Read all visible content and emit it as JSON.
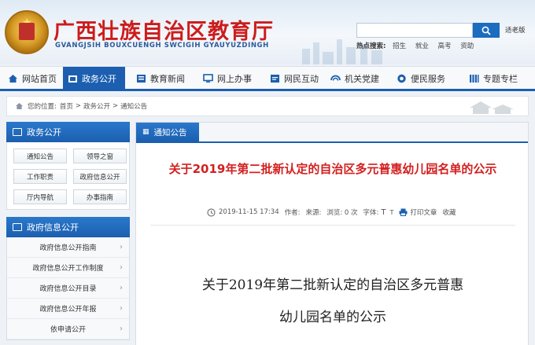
{
  "header": {
    "site_title": "广西壮族自治区教育厅",
    "site_subtitle": "GVANGJSIH BOUXCUENGH SWCIGIH GYAUYUZDINGH",
    "accessibility_label": "适老版",
    "hot_search": {
      "label": "热点搜索:",
      "keywords": [
        "招生",
        "就业",
        "高考",
        "资助"
      ]
    }
  },
  "nav": {
    "items": [
      {
        "label": "网站首页",
        "icon": "home-icon"
      },
      {
        "label": "政务公开",
        "icon": "folder-icon",
        "active": true
      },
      {
        "label": "教育新闻",
        "icon": "news-icon"
      },
      {
        "label": "网上办事",
        "icon": "monitor-icon"
      },
      {
        "label": "网民互动",
        "icon": "chat-icon"
      },
      {
        "label": "机关党建",
        "icon": "flag-icon"
      },
      {
        "label": "便民服务",
        "icon": "service-icon"
      },
      {
        "label": "专题专栏",
        "icon": "columns-icon"
      }
    ]
  },
  "breadcrumb": {
    "prefix": "您的位置:",
    "items": [
      "首页",
      "政务公开",
      "通知公告"
    ]
  },
  "sidebar": {
    "panel1_title": "政务公开",
    "buttons": [
      "通知公告",
      "领导之窗",
      "工作职责",
      "政府信息公开",
      "厅内导航",
      "办事指南"
    ],
    "panel2_title": "政府信息公开",
    "list": [
      "政府信息公开指南",
      "政府信息公开工作制度",
      "政府信息公开目录",
      "政府信息公开年报",
      "依申请公开"
    ]
  },
  "main": {
    "tab_label": "通知公告",
    "article_title": "关于2019年第二批新认定的自治区多元普惠幼儿园名单的公示",
    "meta": {
      "date": "2019-11-15 17:34",
      "author_label": "作者:",
      "source_label": "来源:",
      "views": "浏览: 0 次",
      "font_label": "字体:",
      "font_large": "T",
      "font_small": "T",
      "print_label": "打印文章",
      "favorite_label": "收藏"
    },
    "body_line1": "关于2019年第二批新认定的自治区多元普惠",
    "body_line2": "幼儿园名单的公示"
  },
  "colors": {
    "brand_blue": "#1b5faf",
    "title_red": "#cc1c1c",
    "article_red": "#d32020"
  }
}
